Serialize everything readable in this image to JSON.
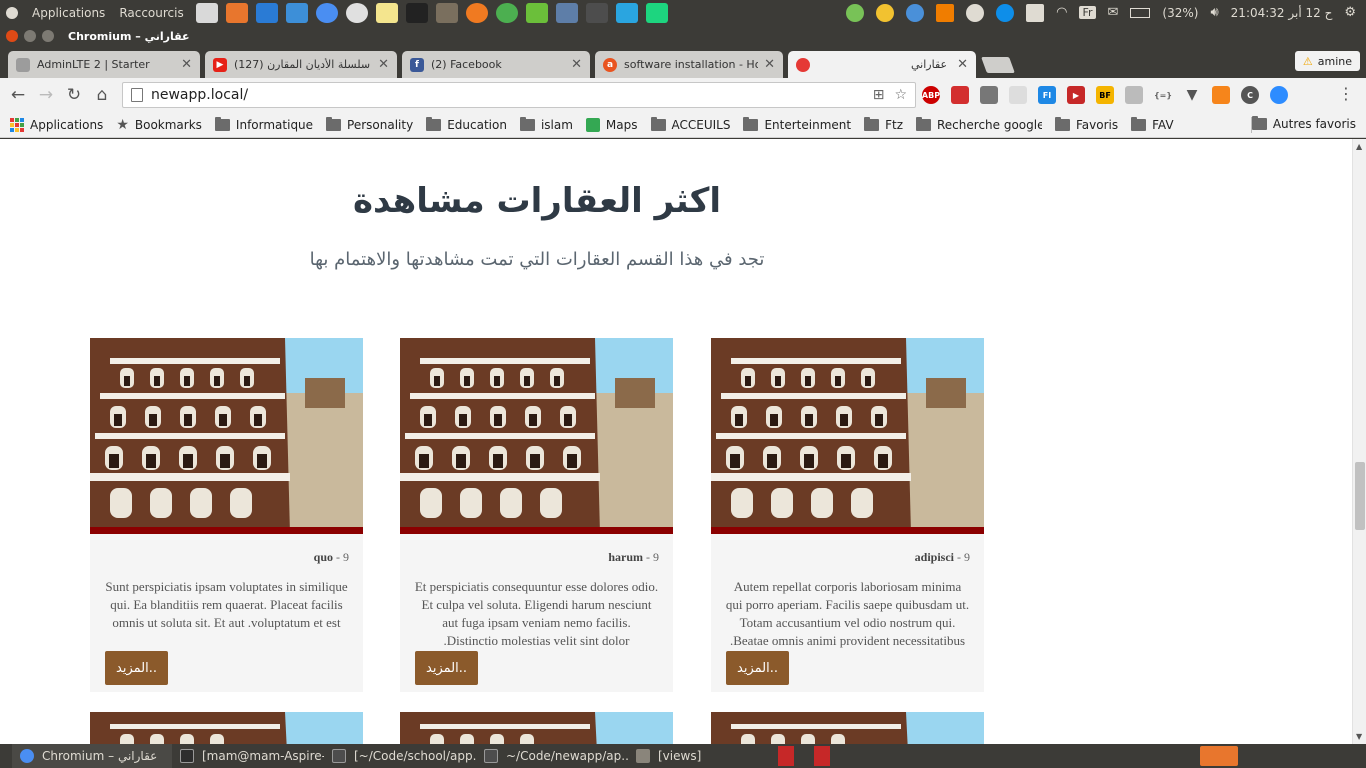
{
  "top_panel": {
    "menu": [
      "Applications",
      "Raccourcis"
    ],
    "tray": {
      "keyboard": "Fr",
      "battery": "(32%)",
      "clock": "21:04:32 ح 12 أبر"
    },
    "launcher_icons": [
      "terminal-icon",
      "files-icon",
      "vscode-icon",
      "screenshot-icon",
      "chromium-icon",
      "opera-icon",
      "notes-icon",
      "inkscape-icon",
      "gimp-icon",
      "firefox-icon",
      "todo-icon",
      "check-icon",
      "drive-icon",
      "sublime-icon",
      "webstorm-icon",
      "pycharm-icon"
    ],
    "tray_icons": [
      "android-icon",
      "cup-icon",
      "weather-icon",
      "vlc-icon",
      "bulb-icon",
      "teamviewer-icon",
      "dropbox-icon",
      "wifi-icon",
      "keyboard-icon",
      "mail-icon",
      "battery-icon",
      "volume-icon"
    ]
  },
  "window": {
    "title": "Chromium – عقاراني"
  },
  "tabs": [
    {
      "label": "AdminLTE 2 | Starter",
      "favicon": "adminlte-icon",
      "color": "#9c9c9c"
    },
    {
      "label": "(127) سلسلة الأديان المقارن",
      "favicon": "youtube-icon",
      "color": "#e62117"
    },
    {
      "label": "(2) Facebook",
      "favicon": "facebook-icon",
      "color": "#3b5998"
    },
    {
      "label": "software installation - How",
      "favicon": "askubuntu-icon",
      "color": "#e95420"
    },
    {
      "label": "عقاراني",
      "favicon": "loading-icon",
      "color": "#e53935"
    }
  ],
  "profile": {
    "name": "amine"
  },
  "omnibox": {
    "url": "newapp.local/"
  },
  "extensions": [
    "abp-icon",
    "pocket-icon",
    "shield-icon",
    "notes-ext-icon",
    "fi-icon",
    "video-icon",
    "bf-icon",
    "chat-icon",
    "json-icon",
    "vue-icon",
    "metamask-icon",
    "cookie-icon",
    "zoom-icon"
  ],
  "bookmarks": {
    "items": [
      {
        "label": "Applications",
        "icon": "apps-grid-icon"
      },
      {
        "label": "Bookmarks",
        "icon": "star-icon"
      },
      {
        "label": "Informatique",
        "icon": "folder-icon"
      },
      {
        "label": "Personality",
        "icon": "folder-icon"
      },
      {
        "label": "Education",
        "icon": "folder-icon"
      },
      {
        "label": "islam",
        "icon": "folder-icon"
      },
      {
        "label": "Maps",
        "icon": "maps-icon"
      },
      {
        "label": "ACCEUILS",
        "icon": "folder-icon"
      },
      {
        "label": "Enterteinment",
        "icon": "folder-icon"
      },
      {
        "label": "Ftz",
        "icon": "folder-icon"
      },
      {
        "label": "Recherche google a tr",
        "icon": "folder-icon"
      },
      {
        "label": "Favoris",
        "icon": "folder-icon"
      },
      {
        "label": "FAV",
        "icon": "folder-icon"
      }
    ],
    "other": "Autres favoris"
  },
  "section": {
    "title": "اكثر العقارات مشاهدة",
    "subtitle": "تجد في هذا القسم العقارات التي تمت مشاهدتها والاهتمام بها"
  },
  "cards": [
    {
      "views": "9",
      "name": "quo",
      "description": "Sunt perspiciatis ipsam voluptates in similique qui. Ea blanditiis rem quaerat. Placeat facilis omnis ut soluta sit. Et aut .voluptatum et est",
      "more": "المزيد.."
    },
    {
      "views": "9",
      "name": "harum",
      "description": "Et perspiciatis consequuntur esse dolores odio. Et culpa vel soluta. Eligendi harum nesciunt aut fuga ipsam veniam nemo facilis. .Distinctio molestias velit sint dolor",
      "more": "المزيد.."
    },
    {
      "views": "9",
      "name": "adipisci",
      "description": "Autem repellat corporis laboriosam minima qui porro aperiam. Facilis saepe quibusdam ut. Totam accusantium vel odio nostrum qui. .Beatae omnis animi provident necessitatibus",
      "more": "المزيد.."
    }
  ],
  "colors": {
    "accent": "#8b5a2b",
    "image_bar": "#8b0000"
  },
  "taskbar": [
    {
      "label": "Chromium – عقاراني",
      "icon": "chromium-icon"
    },
    {
      "label": "[mam@mam-Aspire-...",
      "icon": "terminal-icon"
    },
    {
      "label": "[~/Code/school/app...",
      "icon": "editor-icon"
    },
    {
      "label": "~/Code/newapp/ap...",
      "icon": "editor-icon"
    },
    {
      "label": "[views]",
      "icon": "files-icon"
    }
  ]
}
